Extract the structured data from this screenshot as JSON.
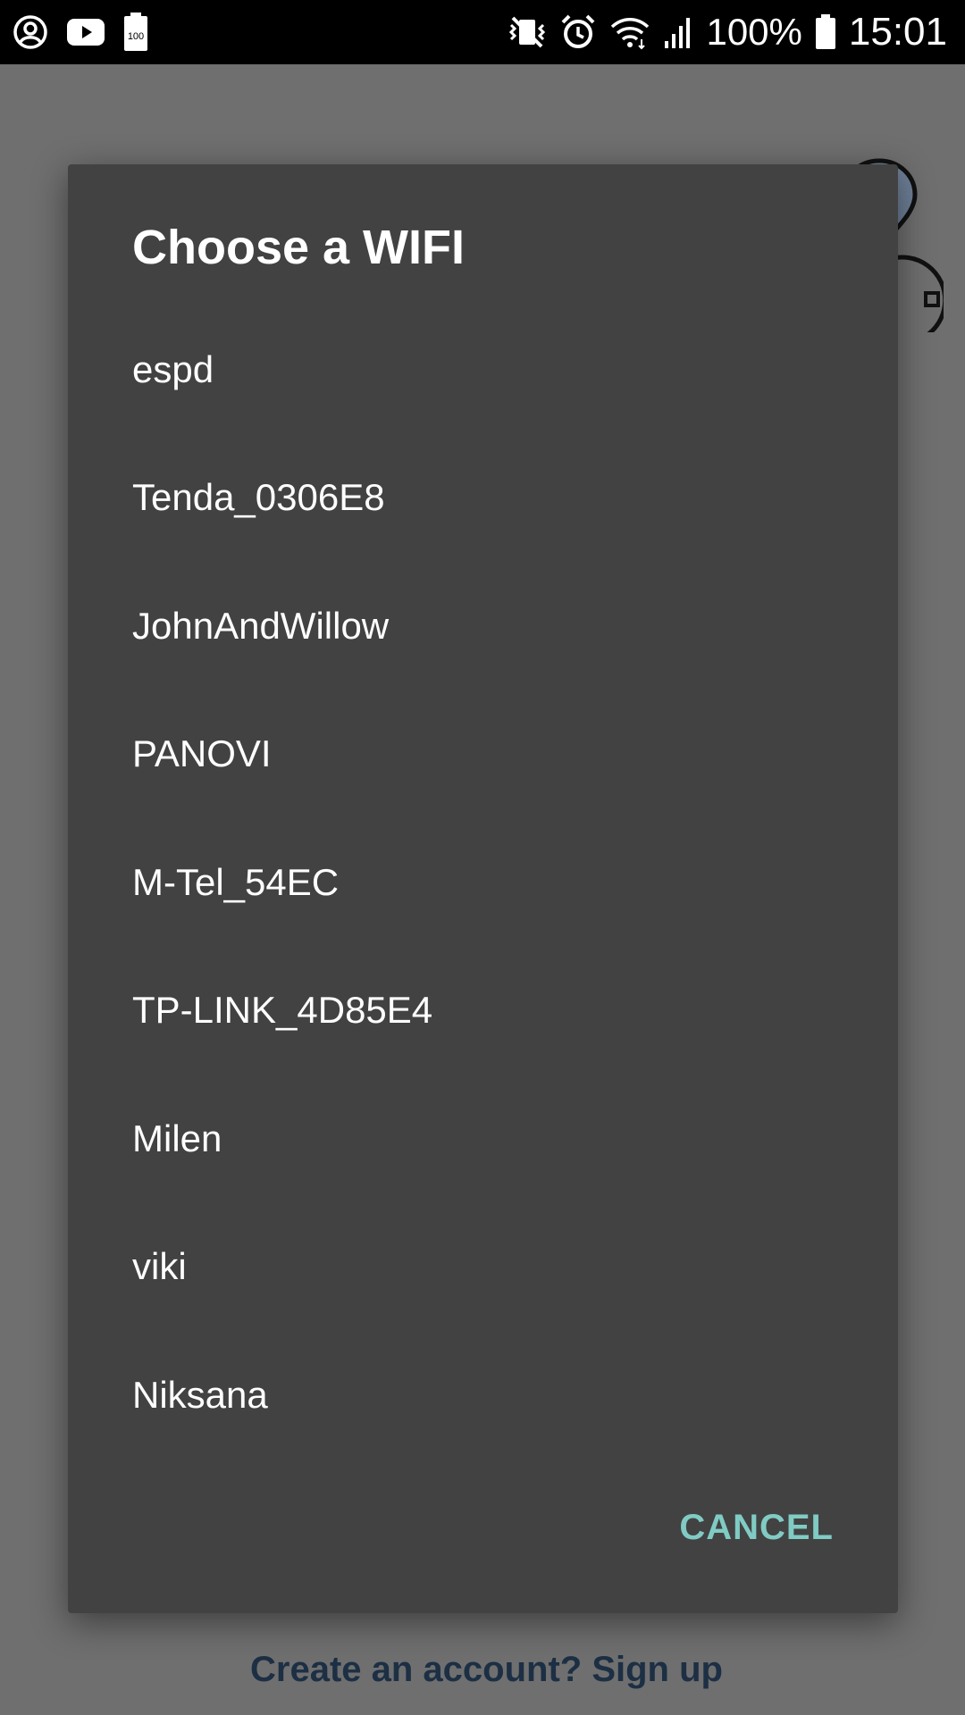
{
  "status_bar": {
    "battery_percent": "100%",
    "time": "15:01",
    "battery_saver_level": "100",
    "icons": [
      "account-icon",
      "youtube-icon",
      "battery-level-icon",
      "vibrate-icon",
      "alarm-icon",
      "wifi-icon",
      "signal-icon",
      "battery-icon"
    ]
  },
  "background": {
    "signup_text": "Create an account? Sign up"
  },
  "dialog": {
    "title": "Choose a WIFI",
    "networks": [
      {
        "label": "espd"
      },
      {
        "label": "Tenda_0306E8"
      },
      {
        "label": "JohnAndWillow"
      },
      {
        "label": "PANOVI"
      },
      {
        "label": "M-Tel_54EC"
      },
      {
        "label": "TP-LINK_4D85E4"
      },
      {
        "label": "Milen"
      },
      {
        "label": "viki"
      },
      {
        "label": "Niksana"
      }
    ],
    "cancel_label": "CANCEL"
  },
  "colors": {
    "dialog_background": "#424242",
    "scrim": "#6f6f6f",
    "accent": "#80cbc4",
    "status_bar": "#000000"
  }
}
